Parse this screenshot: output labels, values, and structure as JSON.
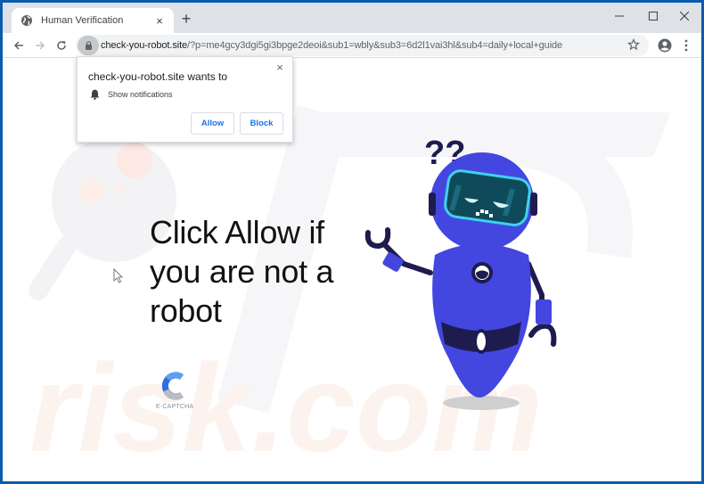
{
  "browser": {
    "tab": {
      "title": "Human Verification",
      "icon": "globe-icon",
      "close_label": "×"
    },
    "new_tab_label": "+",
    "window_controls": {
      "minimize": "minimize-icon",
      "maximize": "maximize-icon",
      "close": "close-icon"
    },
    "toolbar": {
      "back": "back-arrow-icon",
      "forward": "forward-arrow-icon",
      "reload": "reload-icon",
      "lock": "lock-icon",
      "url_host": "check-you-robot.site",
      "url_path": "/?p=me4gcy3dgi5gi3bpge2deoi&sub1=wbly&sub3=6d2l1vai3hl&sub4=daily+local+guide",
      "bookmark": "star-icon",
      "profile": "account-circle-icon",
      "menu": "kebab-menu-icon"
    }
  },
  "permission_popup": {
    "title": "check-you-robot.site wants to",
    "permission_icon": "bell-icon",
    "permission_label": "Show notifications",
    "allow_label": "Allow",
    "block_label": "Block",
    "close_label": "×"
  },
  "page": {
    "headline_lines": [
      "Click Allow if",
      "you are not a",
      "robot"
    ],
    "captcha_label": "E-CAPTCHA",
    "robot_question_marks": "??",
    "watermark_text": "risk.com"
  },
  "colors": {
    "window_frame": "#0b5cad",
    "titlebar": "#dee1e6",
    "omnibox": "#f1f3f4",
    "button_text": "#1a73e8",
    "robot_body": "#4347e0",
    "robot_dark": "#1e1c4e",
    "visor": "#0f4a5a",
    "visor_rim": "#3fd2ef",
    "captcha_blue": "#2d6fdc",
    "captcha_gray": "#b8bcc2"
  }
}
